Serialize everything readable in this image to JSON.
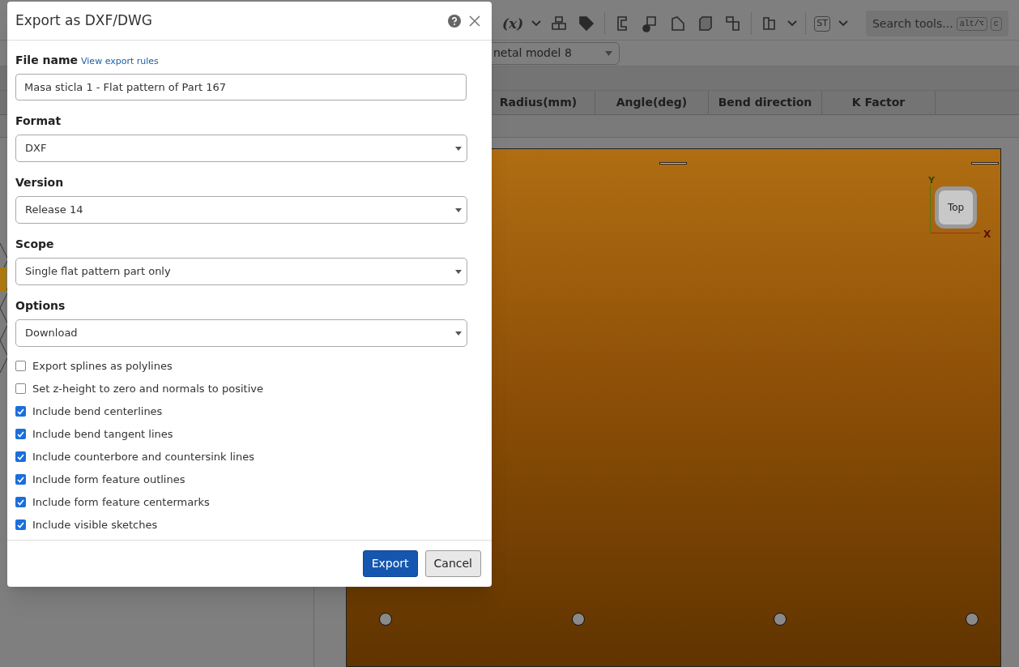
{
  "background": {
    "toolbar": {
      "variable_button": "(x)",
      "style_button": "ST",
      "search": {
        "placeholder": "Search tools...",
        "keys": [
          "alt/⌥",
          "c"
        ]
      }
    },
    "model_select": {
      "value": "netal model 8"
    },
    "table": {
      "columns": [
        "Radius(mm)",
        "Angle(deg)",
        "Bend direction",
        "K Factor"
      ]
    },
    "view_cube": {
      "face": "Top",
      "x_axis": "X",
      "y_axis": "Y"
    }
  },
  "dialog": {
    "title": "Export as DXF/DWG",
    "file_name": {
      "label": "File name",
      "link": "View export rules",
      "value": "Masa sticla 1 - Flat pattern of Part 167"
    },
    "selects": [
      {
        "label": "Format",
        "value": "DXF"
      },
      {
        "label": "Version",
        "value": "Release 14"
      },
      {
        "label": "Scope",
        "value": "Single flat pattern part only"
      },
      {
        "label": "Options",
        "value": "Download"
      }
    ],
    "checkboxes": [
      {
        "label": "Export splines as polylines",
        "checked": false
      },
      {
        "label": "Set z-height to zero and normals to positive",
        "checked": false
      },
      {
        "label": "Include bend centerlines",
        "checked": true
      },
      {
        "label": "Include bend tangent lines",
        "checked": true
      },
      {
        "label": "Include counterbore and countersink lines",
        "checked": true
      },
      {
        "label": "Include form feature outlines",
        "checked": true
      },
      {
        "label": "Include form feature centermarks",
        "checked": true
      },
      {
        "label": "Include visible sketches",
        "checked": true
      }
    ],
    "buttons": [
      {
        "label": "Export",
        "kind": "primary"
      },
      {
        "label": "Cancel",
        "kind": "secondary"
      }
    ]
  }
}
